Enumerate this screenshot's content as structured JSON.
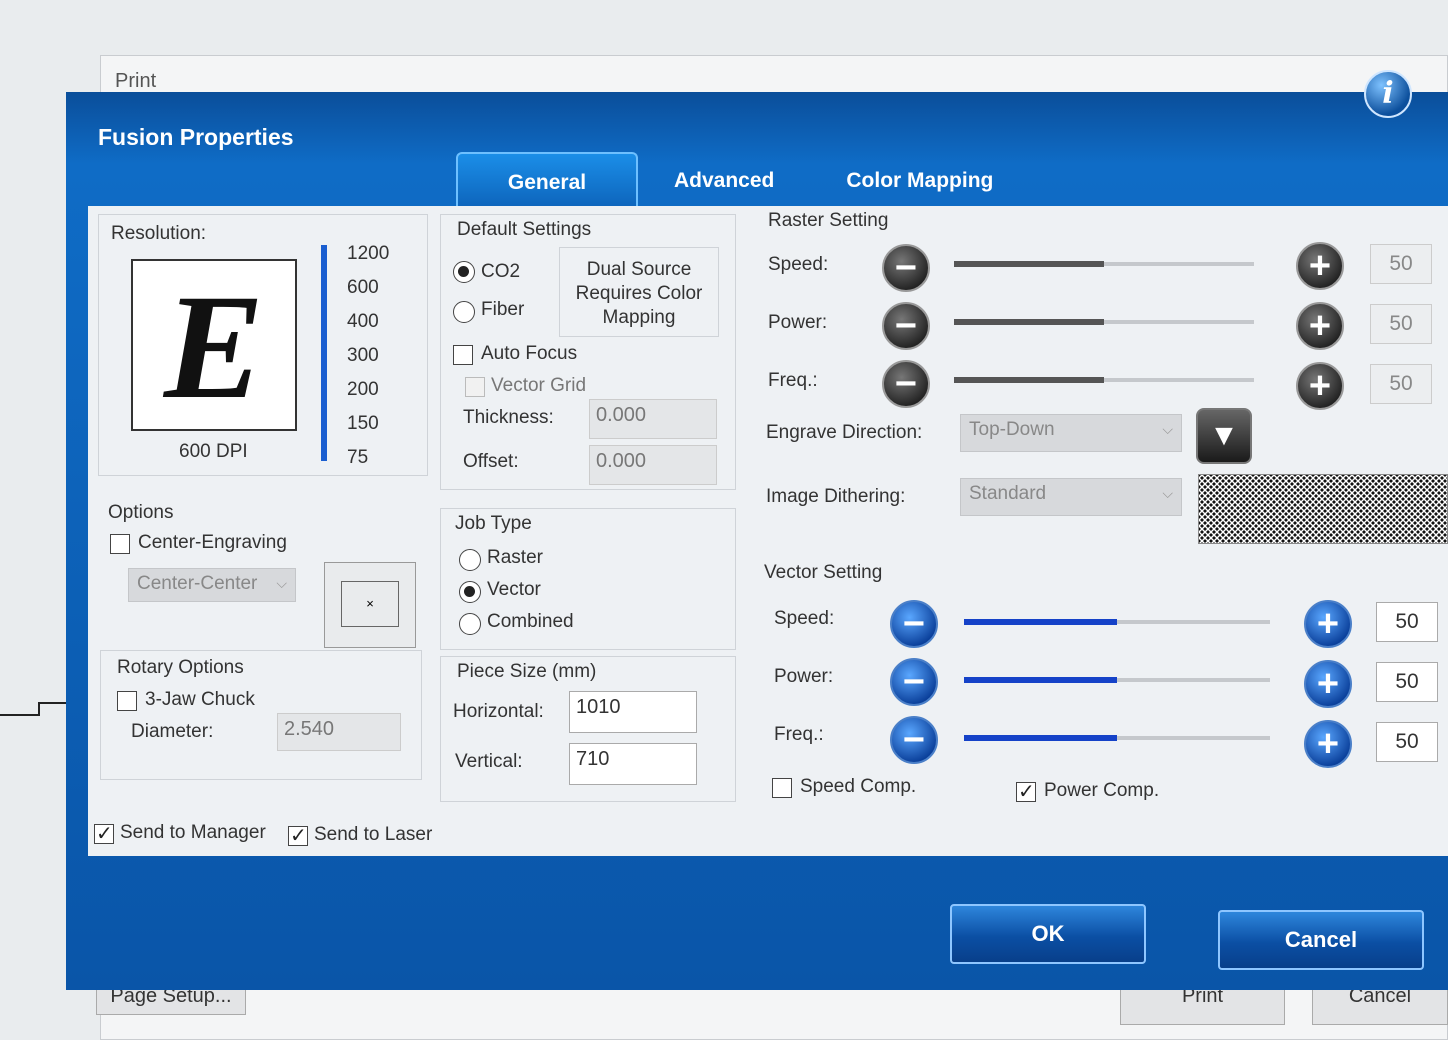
{
  "background_window": {
    "title": "Print",
    "page_setup_label": "Page Setup...",
    "print_label": "Print",
    "cancel_label": "Cancel"
  },
  "dialog": {
    "title": "Fusion Properties",
    "info_icon": "i",
    "tabs": [
      {
        "label": "General",
        "active": true
      },
      {
        "label": "Advanced"
      },
      {
        "label": "Color Mapping"
      }
    ]
  },
  "resolution": {
    "label": "Resolution:",
    "preview_letter": "E",
    "dpi_label": "600 DPI",
    "ticks": [
      "1200",
      "600",
      "400",
      "300",
      "200",
      "150",
      "75"
    ],
    "selected": "600"
  },
  "options": {
    "label": "Options",
    "center_engraving": {
      "label": "Center-Engraving",
      "checked": false
    },
    "center_combo": "Center-Center",
    "grid_mark": "×"
  },
  "rotary": {
    "label": "Rotary Options",
    "three_jaw": {
      "label": "3-Jaw Chuck",
      "checked": false
    },
    "diameter_label": "Diameter:",
    "diameter_value": "2.540"
  },
  "default_settings": {
    "label": "Default Settings",
    "co2_label": "CO2",
    "fiber_label": "Fiber",
    "selected": "CO2",
    "note": [
      "Dual Source",
      "Requires Color",
      "Mapping"
    ],
    "auto_focus": {
      "label": "Auto Focus",
      "checked": false
    },
    "vector_grid": {
      "label": "Vector Grid",
      "checked": false
    },
    "thickness_label": "Thickness:",
    "thickness_value": "0.000",
    "offset_label": "Offset:",
    "offset_value": "0.000"
  },
  "job_type": {
    "label": "Job Type",
    "options": [
      "Raster",
      "Vector",
      "Combined"
    ],
    "selected": "Vector"
  },
  "piece_size": {
    "label": "Piece Size (mm)",
    "horizontal_label": "Horizontal:",
    "horizontal_value": "1010",
    "vertical_label": "Vertical:",
    "vertical_value": "710"
  },
  "raster": {
    "label": "Raster Setting",
    "rows": [
      {
        "label": "Speed:",
        "value": "50",
        "fraction": 0.5
      },
      {
        "label": "Power:",
        "value": "50",
        "fraction": 0.5
      },
      {
        "label": "Freq.:",
        "value": "50",
        "fraction": 0.5
      }
    ],
    "engrave_direction_label": "Engrave Direction:",
    "engrave_direction_value": "Top-Down",
    "image_dithering_label": "Image Dithering:",
    "image_dithering_value": "Standard"
  },
  "vector": {
    "label": "Vector Setting",
    "rows": [
      {
        "label": "Speed:",
        "value": "50",
        "fraction": 0.5
      },
      {
        "label": "Power:",
        "value": "50",
        "fraction": 0.5
      },
      {
        "label": "Freq.:",
        "value": "50",
        "fraction": 0.5
      }
    ],
    "speed_comp": {
      "label": "Speed Comp.",
      "checked": false
    },
    "power_comp": {
      "label": "Power Comp.",
      "checked": true
    }
  },
  "footer": {
    "send_to_manager": {
      "label": "Send to Manager",
      "checked": true
    },
    "send_to_laser": {
      "label": "Send to Laser",
      "checked": true
    },
    "ok_label": "OK",
    "cancel_label": "Cancel"
  },
  "icons": {
    "minus": "−",
    "plus": "+",
    "down_arrow": "▼",
    "combo_arrow": "⌵"
  },
  "colors": {
    "dialog_blue": "#0f6cc6",
    "vector_blue": "#1542c8"
  }
}
